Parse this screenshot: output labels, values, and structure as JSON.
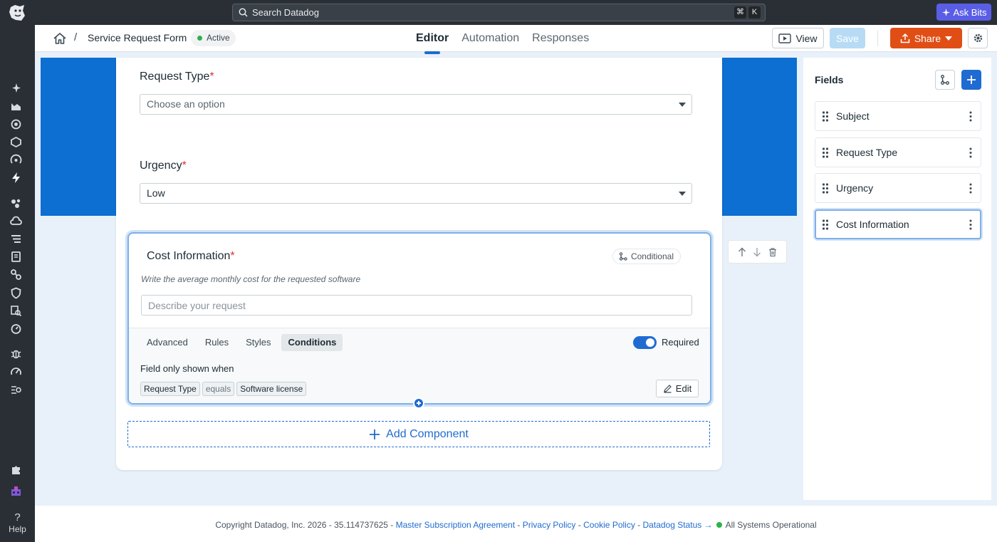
{
  "topbar": {
    "search_placeholder": "Search Datadog",
    "shortcut_keys": [
      "⌘",
      "K"
    ],
    "ask_bits_label": "Ask Bits"
  },
  "leftnav": {
    "help_label": "Help"
  },
  "header": {
    "breadcrumb_sep": "/",
    "form_title": "Service Request Form",
    "status": "Active",
    "tabs": [
      {
        "label": "Editor",
        "active": true
      },
      {
        "label": "Automation",
        "active": false
      },
      {
        "label": "Responses",
        "active": false
      }
    ],
    "view_label": "View",
    "save_label": "Save",
    "share_label": "Share"
  },
  "form": {
    "request_type": {
      "label": "Request Type",
      "required_mark": "*",
      "placeholder": "Choose an option"
    },
    "urgency": {
      "label": "Urgency",
      "required_mark": "*",
      "value": "Low"
    },
    "cost_info": {
      "label": "Cost Information",
      "required_mark": "*",
      "conditional_label": "Conditional",
      "help_text": "Write the average monthly cost for the requested software",
      "input_placeholder": "Describe your request",
      "subtabs": [
        {
          "label": "Advanced",
          "active": false
        },
        {
          "label": "Rules",
          "active": false
        },
        {
          "label": "Styles",
          "active": false
        },
        {
          "label": "Conditions",
          "active": true
        }
      ],
      "required_label": "Required",
      "required_on": true,
      "shown_when_label": "Field only shown when",
      "condition": {
        "field": "Request Type",
        "operator": "equals",
        "value": "Software license"
      },
      "edit_label": "Edit"
    },
    "add_component_label": "Add Component"
  },
  "fields_panel": {
    "title": "Fields",
    "items": [
      {
        "name": "Subject",
        "selected": false
      },
      {
        "name": "Request Type",
        "selected": false
      },
      {
        "name": "Urgency",
        "selected": false
      },
      {
        "name": "Cost Information",
        "selected": true
      }
    ]
  },
  "footer": {
    "copyright": "Copyright Datadog, Inc. 2026 - 35.114737625 -",
    "links": [
      "Master Subscription Agreement",
      "Privacy Policy",
      "Cookie Policy",
      "Datadog Status →"
    ],
    "separator": "-",
    "status_text": "All Systems Operational"
  },
  "colors": {
    "brand_blue": "#0c6fd1",
    "accent_blue": "#1f6bd1",
    "share_orange": "#e04e16",
    "ask_bits_purple": "#5a5ee6",
    "status_green": "#2bb24c"
  }
}
